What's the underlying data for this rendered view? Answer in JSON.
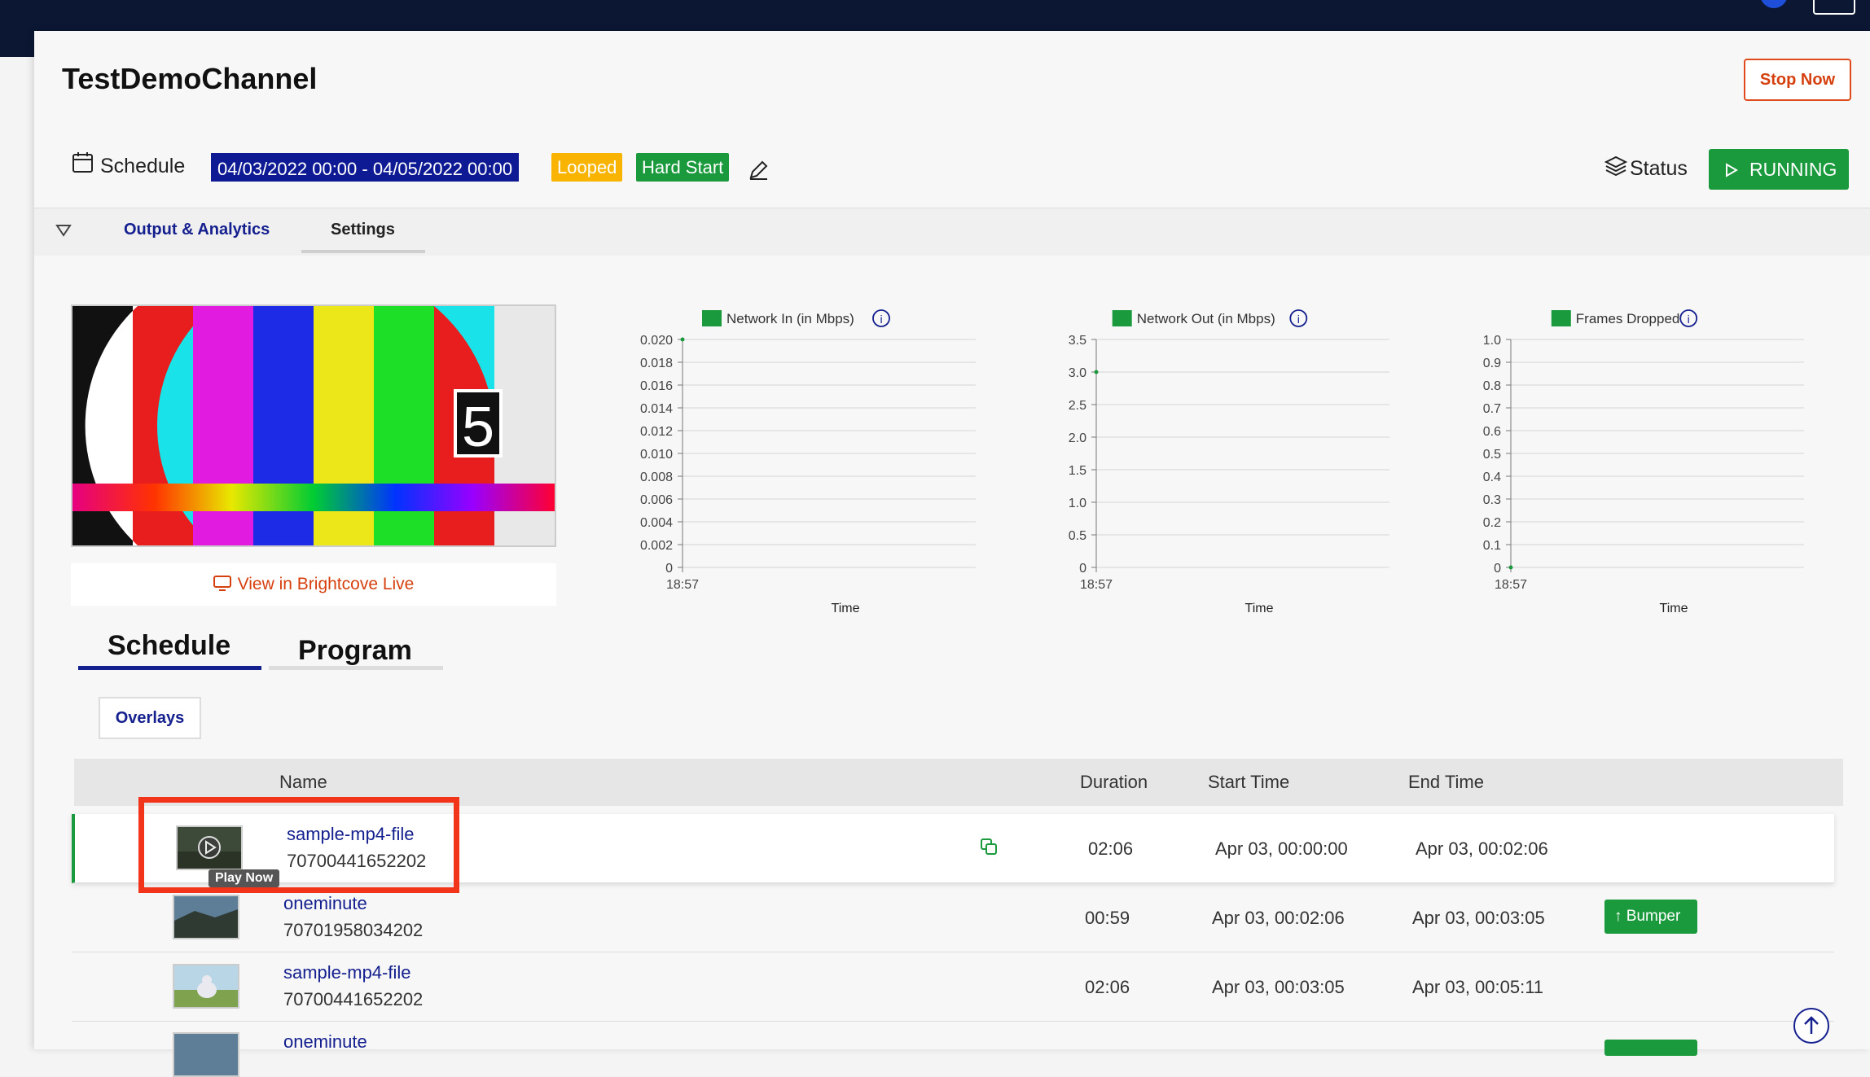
{
  "channel_title": "TestDemoChannel",
  "header": {
    "stop_label": "Stop Now",
    "schedule_label": "Schedule",
    "date_range": "04/03/2022 00:00 - 04/05/2022 00:00",
    "looped_badge": "Looped",
    "hardstart_badge": "Hard Start",
    "status_label": "Status",
    "running_label": "RUNNING"
  },
  "tabs": {
    "output": "Output & Analytics",
    "settings": "Settings"
  },
  "preview": {
    "view_link": "View in Brightcove Live",
    "countdown_digit": "5"
  },
  "charts": {
    "xlabel": "Time",
    "tick_time": "18:57"
  },
  "chart_data": [
    {
      "type": "line",
      "title": "Network In (in Mbps)",
      "series": [
        {
          "name": "Network In (in Mbps)",
          "x": [
            "18:57"
          ],
          "values": [
            0.02
          ]
        }
      ],
      "xlabel": "Time",
      "ylabel": "",
      "ylim": [
        0,
        0.02
      ],
      "yticks": [
        "0.020",
        "0.018",
        "0.016",
        "0.014",
        "0.012",
        "0.010",
        "0.008",
        "0.006",
        "0.004",
        "0.002",
        "0"
      ],
      "grid": true,
      "legend": "top",
      "color": "#1a9a3c"
    },
    {
      "type": "line",
      "title": "Network Out (in Mbps)",
      "series": [
        {
          "name": "Network Out (in Mbps)",
          "x": [
            "18:57"
          ],
          "values": [
            3.0
          ]
        }
      ],
      "xlabel": "Time",
      "ylabel": "",
      "ylim": [
        0,
        3.5
      ],
      "yticks": [
        "3.5",
        "3.0",
        "2.5",
        "2.0",
        "1.5",
        "1.0",
        "0.5",
        "0"
      ],
      "grid": true,
      "legend": "top",
      "color": "#1a9a3c"
    },
    {
      "type": "line",
      "title": "Frames Dropped",
      "series": [
        {
          "name": "Frames Dropped",
          "x": [
            "18:57"
          ],
          "values": [
            0
          ]
        }
      ],
      "xlabel": "Time",
      "ylabel": "",
      "ylim": [
        0,
        1.0
      ],
      "yticks": [
        "1.0",
        "0.9",
        "0.8",
        "0.7",
        "0.6",
        "0.5",
        "0.4",
        "0.3",
        "0.2",
        "0.1",
        "0"
      ],
      "grid": true,
      "legend": "top",
      "color": "#1a9a3c"
    }
  ],
  "subtabs": {
    "schedule": "Schedule",
    "program": "Program"
  },
  "overlays_label": "Overlays",
  "table": {
    "headers": {
      "name": "Name",
      "duration": "Duration",
      "start": "Start Time",
      "end": "End Time"
    },
    "tooltip": "Play Now",
    "rows": [
      {
        "name": "sample-mp4-file",
        "id": "70700441652202",
        "duration": "02:06",
        "start": "Apr 03, 00:00:00",
        "end": "Apr 03, 00:02:06",
        "tag": ""
      },
      {
        "name": "oneminute",
        "id": "70701958034202",
        "duration": "00:59",
        "start": "Apr 03, 00:02:06",
        "end": "Apr 03, 00:03:05",
        "tag": "Bumper"
      },
      {
        "name": "sample-mp4-file",
        "id": "70700441652202",
        "duration": "02:06",
        "start": "Apr 03, 00:03:05",
        "end": "Apr 03, 00:05:11",
        "tag": ""
      },
      {
        "name": "oneminute",
        "id": "",
        "duration": "",
        "start": "",
        "end": "",
        "tag": ""
      }
    ]
  },
  "colors": {
    "brand_blue": "#15208f",
    "green": "#1a9a3c",
    "orange": "#d6400f",
    "amber": "#f8b400",
    "topbar": "#0b1733"
  }
}
